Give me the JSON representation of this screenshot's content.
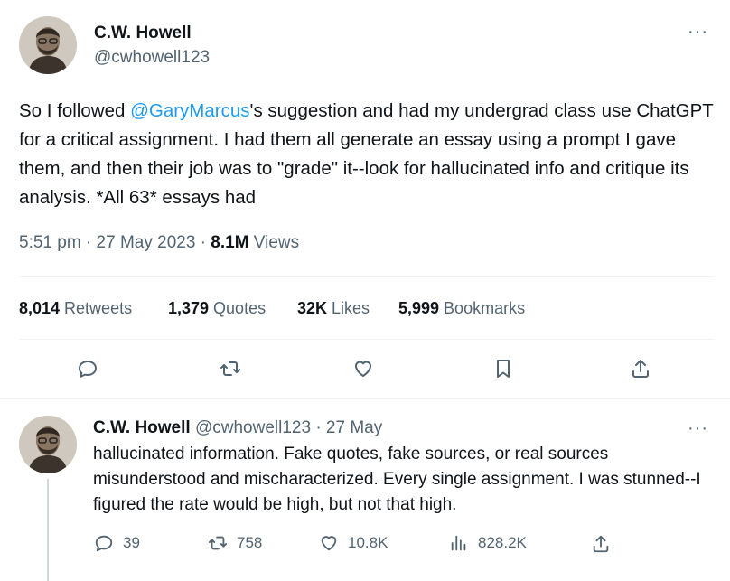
{
  "main_tweet": {
    "author_name": "C.W. Howell",
    "author_handle": "@cwhowell123",
    "more_label": "···",
    "text_before": "So I followed ",
    "mention": "@GaryMarcus",
    "text_after": "'s suggestion and had my undergrad class use ChatGPT for a critical assignment. I had them all generate an essay using a prompt I gave them, and then their job was to \"grade\" it--look for hallucinated info and critique its analysis. *All 63* essays had",
    "time": "5:51 pm · 27 May 2023 · ",
    "views_count": "8.1M",
    "views_label": " Views",
    "stats": [
      {
        "count": "8,014",
        "label": " Retweets"
      },
      {
        "count": "1,379",
        "label": " Quotes"
      },
      {
        "count": "32K",
        "label": " Likes"
      },
      {
        "count": "5,999",
        "label": " Bookmarks"
      }
    ]
  },
  "reply": {
    "author_name": "C.W. Howell",
    "author_handle_date": " @cwhowell123 · 27 May",
    "more_label": "···",
    "text": "hallucinated information. Fake quotes, fake sources, or real sources misunderstood and mischaracterized. Every single assignment. I was stunned--I figured the rate would be high, but not that high.",
    "replies": "39",
    "retweets": "758",
    "likes": "10.8K",
    "views": "828.2K"
  },
  "colors": {
    "text": "#0f1419",
    "secondary": "#536471",
    "accent": "#1d9bf0",
    "divider": "#eff3f4"
  },
  "icons": [
    "reply-icon",
    "retweet-icon",
    "like-icon",
    "bookmark-icon",
    "share-icon",
    "views-icon",
    "more-icon"
  ]
}
